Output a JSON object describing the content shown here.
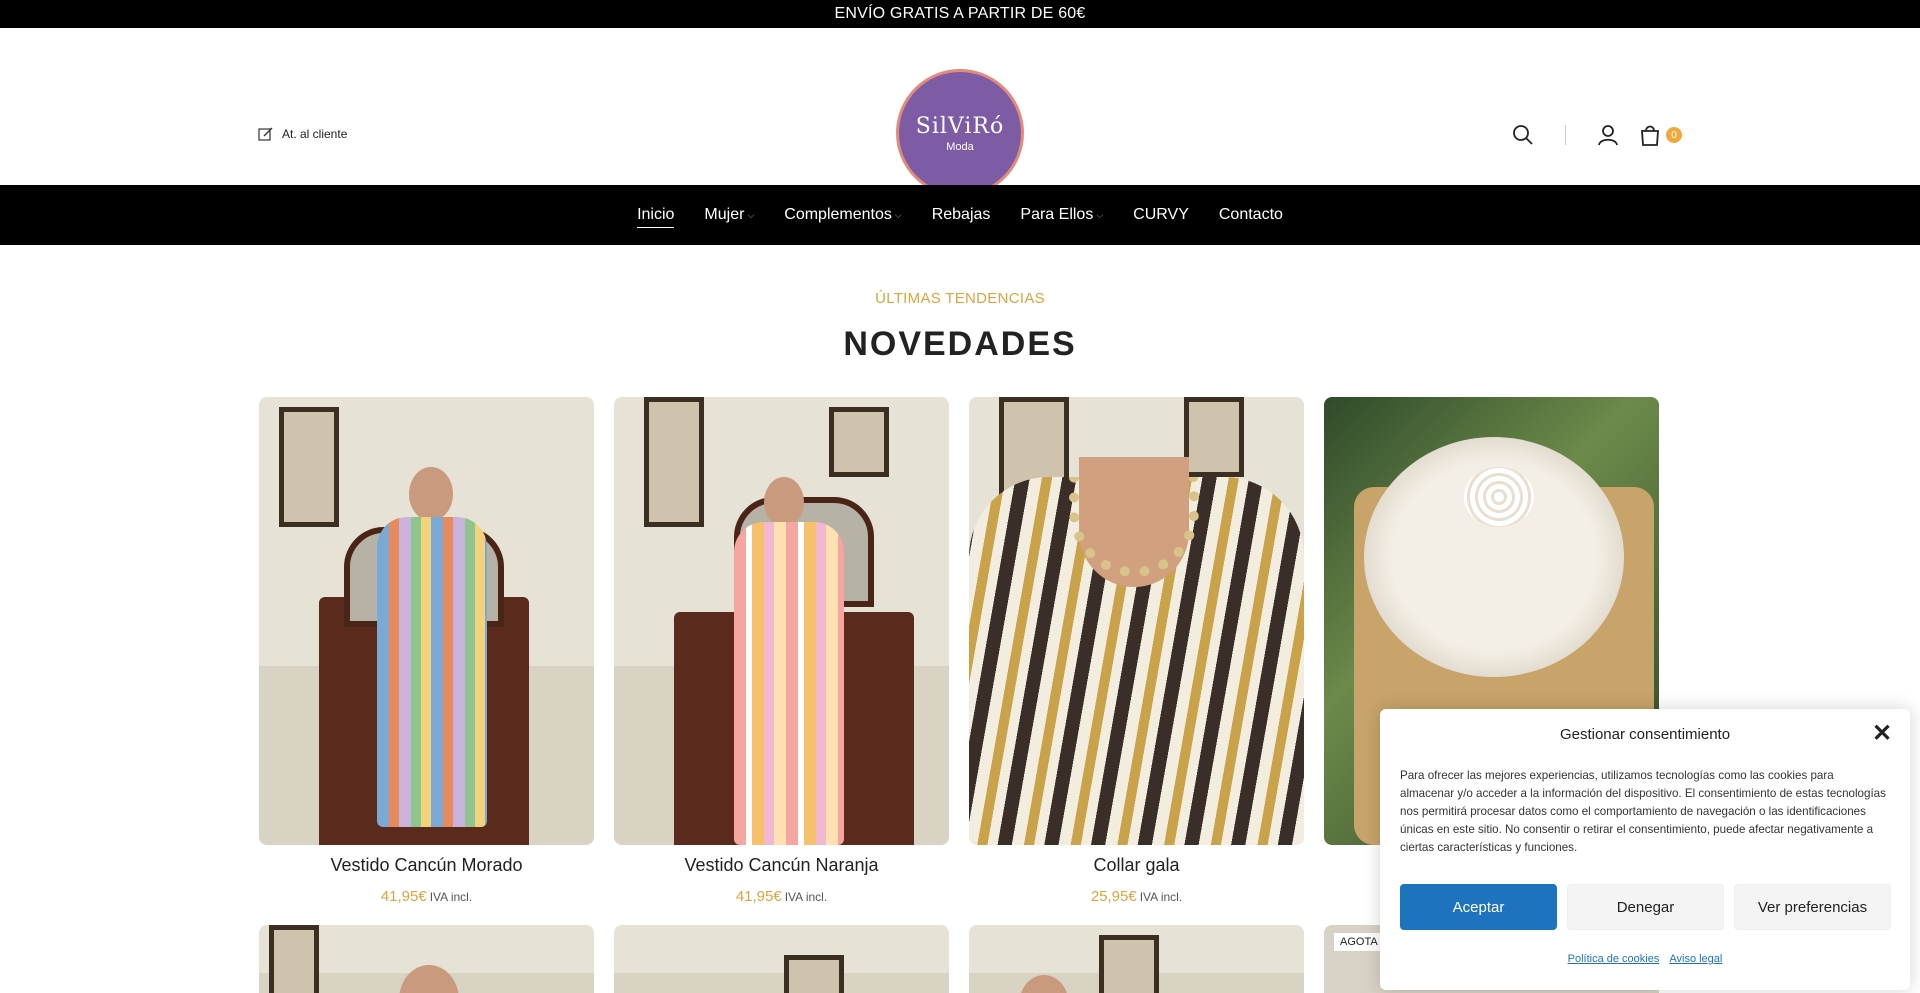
{
  "topbar": {
    "text": "ENVÍO GRATIS A PARTIR DE 60€"
  },
  "header": {
    "customer_link": "At. al cliente",
    "logo_main": "SilViRó",
    "logo_sub": "Moda",
    "cart_count": "0"
  },
  "nav": {
    "items": [
      {
        "label": "Inicio"
      },
      {
        "label": "Mujer"
      },
      {
        "label": "Complementos"
      },
      {
        "label": "Rebajas"
      },
      {
        "label": "Para Ellos"
      },
      {
        "label": "CURVY"
      },
      {
        "label": "Contacto"
      }
    ]
  },
  "section": {
    "subtitle": "ÚLTIMAS TENDENCIAS",
    "title": "NOVEDADES"
  },
  "products": [
    {
      "name": "Vestido Cancún Morado",
      "price": "41,95€",
      "vat": "IVA incl."
    },
    {
      "name": "Vestido Cancún Naranja",
      "price": "41,95€",
      "vat": "IVA incl."
    },
    {
      "name": "Collar gala",
      "price": "25,95€",
      "vat": "IVA incl."
    },
    {
      "name": "",
      "price": "",
      "vat": ""
    }
  ],
  "row2": {
    "sold_badge": "AGOTA"
  },
  "consent": {
    "title": "Gestionar consentimiento",
    "text": "Para ofrecer las mejores experiencias, utilizamos tecnologías como las cookies para almacenar y/o acceder a la información del dispositivo. El consentimiento de estas tecnologías nos permitirá procesar datos como el comportamiento de navegación o las identificaciones únicas en este sitio. No consentir o retirar el consentimiento, puede afectar negativamente a ciertas características y funciones.",
    "accept": "Aceptar",
    "deny": "Denegar",
    "preferences": "Ver preferencias",
    "cookie_policy": "Política de cookies",
    "legal": "Aviso legal"
  },
  "colors": {
    "accent": "#e0a23c",
    "nav_bg": "#000000",
    "logo_bg": "#7d5ca5",
    "primary_button": "#1e73be"
  }
}
